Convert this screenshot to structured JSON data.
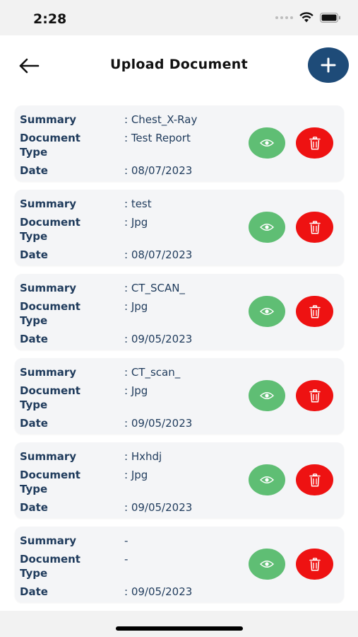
{
  "status": {
    "time": "2:28"
  },
  "header": {
    "title": "Upload Document"
  },
  "labels": {
    "summary": "Summary",
    "doc_line1": "Document",
    "doc_line2": "Type",
    "date": "Date"
  },
  "documents": [
    {
      "summary": ": Chest_X-Ray",
      "type": ": Test Report",
      "date": ": 08/07/2023"
    },
    {
      "summary": ": test",
      "type": ": Jpg",
      "date": ": 08/07/2023"
    },
    {
      "summary": ": CT_SCAN_",
      "type": ": Jpg",
      "date": ": 09/05/2023"
    },
    {
      "summary": ": CT_scan_",
      "type": ": Jpg",
      "date": ": 09/05/2023"
    },
    {
      "summary": ": Hxhdj",
      "type": ": Jpg",
      "date": ": 09/05/2023"
    },
    {
      "summary": "-",
      "type": "-",
      "date": ": 09/05/2023"
    }
  ],
  "colors": {
    "add_button": "#1e4b78",
    "view_button": "#5fbe74",
    "delete_button": "#ee1212",
    "label_text": "#1f3b5c",
    "card_bg": "#f4f5f7"
  },
  "icons": {
    "back": "arrow-left-icon",
    "add": "plus-icon",
    "view": "eye-icon",
    "delete": "trash-icon"
  }
}
